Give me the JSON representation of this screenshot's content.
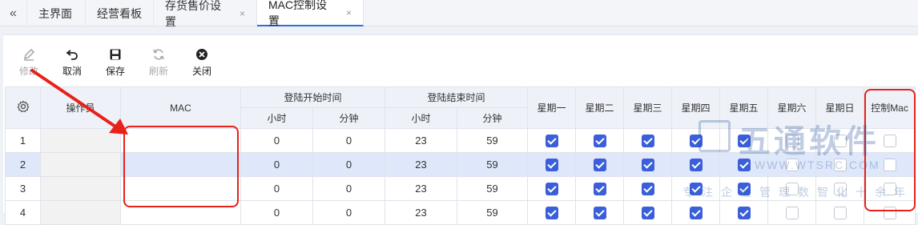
{
  "tabs": [
    {
      "label": "主界面",
      "closable": false,
      "active": false
    },
    {
      "label": "经营看板",
      "closable": false,
      "active": false
    },
    {
      "label": "存货售价设置",
      "closable": true,
      "active": false
    },
    {
      "label": "MAC控制设置",
      "closable": true,
      "active": true
    }
  ],
  "tab_close_glyph": "×",
  "tab_back_glyph": "«",
  "toolbar": [
    {
      "key": "edit",
      "label": "修改",
      "icon": "pencil-icon",
      "disabled": true
    },
    {
      "key": "cancel",
      "label": "取消",
      "icon": "undo-icon",
      "disabled": false
    },
    {
      "key": "save",
      "label": "保存",
      "icon": "save-icon",
      "disabled": false
    },
    {
      "key": "refresh",
      "label": "刷新",
      "icon": "refresh-icon",
      "disabled": true
    },
    {
      "key": "close",
      "label": "关闭",
      "icon": "close-circle-icon",
      "disabled": false
    }
  ],
  "table": {
    "headers": {
      "operator": "操作员",
      "mac": "MAC",
      "login_start": "登陆开始时间",
      "login_end": "登陆结束时间",
      "hour": "小时",
      "minute": "分钟",
      "mon": "星期一",
      "tue": "星期二",
      "wed": "星期三",
      "thu": "星期四",
      "fri": "星期五",
      "sat": "星期六",
      "sun": "星期日",
      "control_mac": "控制Mac"
    },
    "rows": [
      {
        "num": "1",
        "operator": "",
        "mac": "",
        "start_h": "0",
        "start_m": "0",
        "end_h": "23",
        "end_m": "59",
        "days": [
          true,
          true,
          true,
          true,
          true,
          false,
          false
        ],
        "control_mac": false,
        "selected": false
      },
      {
        "num": "2",
        "operator": "",
        "mac": "",
        "start_h": "0",
        "start_m": "0",
        "end_h": "23",
        "end_m": "59",
        "days": [
          true,
          true,
          true,
          true,
          true,
          false,
          false
        ],
        "control_mac": false,
        "selected": true
      },
      {
        "num": "3",
        "operator": "",
        "mac": "",
        "start_h": "0",
        "start_m": "0",
        "end_h": "23",
        "end_m": "59",
        "days": [
          true,
          true,
          true,
          true,
          true,
          false,
          false
        ],
        "control_mac": false,
        "selected": false
      },
      {
        "num": "4",
        "operator": "",
        "mac": "",
        "start_h": "0",
        "start_m": "0",
        "end_h": "23",
        "end_m": "59",
        "days": [
          true,
          true,
          true,
          true,
          true,
          false,
          false
        ],
        "control_mac": false,
        "selected": false
      }
    ]
  },
  "colors": {
    "accent": "#3b5fd9",
    "callout": "#e8221b",
    "tab_active_underline": "#2d6ee0"
  },
  "watermark": {
    "title": "五通软件",
    "url": "WWW.WTSRC.COM",
    "slogan": "专注企业管理数智化十余年"
  }
}
